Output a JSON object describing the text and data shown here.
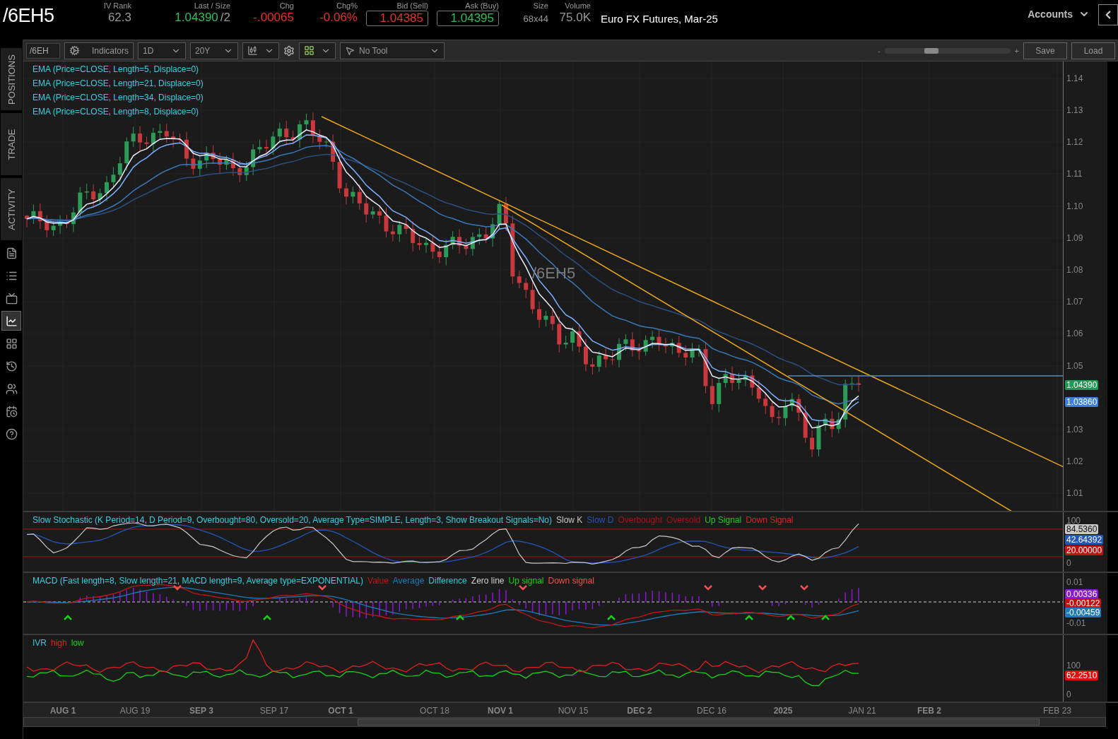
{
  "header": {
    "symbol": "/6EH5",
    "quotes": [
      {
        "label": "IV Rank",
        "value": "62.3",
        "color": "#999999",
        "kind": "plain"
      },
      {
        "label": "Last / Size",
        "value": "1.04390",
        "suffix": "/2",
        "color": "#2fbf5a",
        "kind": "plain"
      },
      {
        "label": "Chg",
        "value": "-.00065",
        "color": "#e8302a",
        "kind": "plain"
      },
      {
        "label": "Chg%",
        "value": "-0.06%",
        "color": "#e8302a",
        "kind": "plain"
      },
      {
        "label": "Bid (Sell)",
        "value": "1.04385",
        "color": "#e8302a",
        "kind": "boxed"
      },
      {
        "label": "Ask (Buy)",
        "value": "1.04395",
        "color": "#2fbf5a",
        "kind": "boxed"
      },
      {
        "label": "Size",
        "value": "68x44",
        "color": "#999999",
        "kind": "small"
      },
      {
        "label": "Volume",
        "value": "75.0K",
        "color": "#999999",
        "kind": "plain"
      }
    ],
    "description": "Euro FX Futures, Mar-25",
    "accounts": "Accounts"
  },
  "sidebar": {
    "tabs": [
      {
        "label": "POSITIONS",
        "selected": false
      },
      {
        "label": "TRADE",
        "selected": false
      },
      {
        "label": "ACTIVITY",
        "selected": false
      }
    ],
    "icons": [
      {
        "selected": false
      },
      {
        "selected": false
      },
      {
        "selected": false
      },
      {
        "selected": true
      },
      {
        "selected": false
      },
      {
        "selected": false
      },
      {
        "selected": false
      },
      {
        "selected": false
      },
      {
        "selected": false
      }
    ]
  },
  "toolbar": {
    "symbol_field": "/6EH",
    "indicators": "Indicators",
    "aggregation": "1D",
    "range": "20Y",
    "tool": "No Tool",
    "zoom_minus": "-",
    "zoom_plus": "+",
    "zoom": {
      "level": 0.36
    },
    "save": "Save",
    "load": "Load"
  },
  "price_pane": {
    "studies": [
      "EMA (Price=CLOSE, Length=5, Displace=0)",
      "EMA (Price=CLOSE, Length=21, Displace=0)",
      "EMA (Price=CLOSE, Length=34, Displace=0)",
      "EMA (Price=CLOSE, Length=8, Displace=0)"
    ],
    "watermark": "/6EH5",
    "axis": [
      "1.14",
      "1.13",
      "1.12",
      "1.11",
      "1.10",
      "1.09",
      "1.08",
      "1.07",
      "1.06",
      "1.05",
      "1.03",
      "1.02",
      "1.01"
    ],
    "badges": [
      {
        "value": "1.04390",
        "color": "#1f9a55"
      },
      {
        "value": "1.03860",
        "color": "#3d7fe0"
      }
    ]
  },
  "stochastic": {
    "title": "Slow Stochastic (K Period=14, D Period=9, Overbought=80, Oversold=20, Average Type=SIMPLE, Length=3, Show Breakout Signals=No)",
    "legend": [
      {
        "label": "Slow K",
        "color": "#c8c8c8"
      },
      {
        "label": "Slow D",
        "color": "#2456b8"
      },
      {
        "label": "Overbought",
        "color": "#a81414"
      },
      {
        "label": "Oversold",
        "color": "#a81414"
      },
      {
        "label": "Up Signal",
        "color": "#18d018"
      },
      {
        "label": "Down Signal",
        "color": "#e02020"
      }
    ],
    "axis": [
      "100",
      "0"
    ],
    "badges": [
      {
        "value": "84.5360",
        "color": "#c8c8c8"
      },
      {
        "value": "42.64392",
        "color": "#2456b8"
      },
      {
        "value": "20.00000",
        "color": "#c01010"
      }
    ]
  },
  "macd": {
    "title": "MACD (Fast length=8, Slow length=21, MACD length=9, Average type=EXPONENTIAL)",
    "legend": [
      {
        "label": "Value",
        "color": "#c01818"
      },
      {
        "label": "Average",
        "color": "#1e7ab8"
      },
      {
        "label": "Difference",
        "color": "#35c8d8"
      },
      {
        "label": "Zero line",
        "color": "#d0d0d0"
      },
      {
        "label": "Up signal",
        "color": "#18d018"
      },
      {
        "label": "Down signal",
        "color": "#f05050"
      }
    ],
    "axis": [
      "0.01",
      "-0.01"
    ],
    "badges": [
      {
        "value": "0.00336",
        "color": "#8a18d8"
      },
      {
        "value": "-0.00122",
        "color": "#c01010"
      },
      {
        "value": "-0.00459",
        "color": "#1e7ab8"
      }
    ]
  },
  "ivr": {
    "legend": [
      {
        "label": "IVR",
        "color": "#35c8d8"
      },
      {
        "label": "high",
        "color": "#e02020"
      },
      {
        "label": "low",
        "color": "#18d018"
      }
    ],
    "axis": [
      "100",
      "0"
    ],
    "badges": [
      {
        "value": "62.2510",
        "color": "#e01010"
      }
    ]
  },
  "time_axis": [
    {
      "label": "AUG 1",
      "major": true
    },
    {
      "label": "AUG 19",
      "major": false
    },
    {
      "label": "SEP 3",
      "major": true
    },
    {
      "label": "SEP 17",
      "major": false
    },
    {
      "label": "OCT 1",
      "major": true
    },
    {
      "label": "OCT 18",
      "major": false
    },
    {
      "label": "NOV 1",
      "major": true
    },
    {
      "label": "NOV 15",
      "major": false
    },
    {
      "label": "DEC 2",
      "major": true
    },
    {
      "label": "DEC 16",
      "major": false
    },
    {
      "label": "2025",
      "major": true
    },
    {
      "label": "JAN 21",
      "major": false
    },
    {
      "label": "FEB 2",
      "major": true
    },
    {
      "label": "FEB 23",
      "major": false
    }
  ]
}
